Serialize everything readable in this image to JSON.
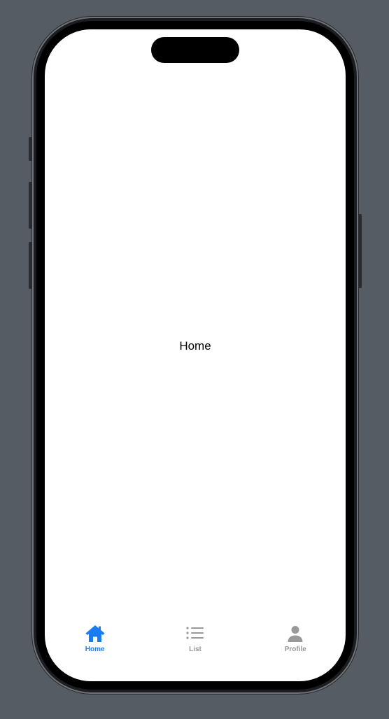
{
  "content": {
    "title": "Home"
  },
  "tab_bar": {
    "items": [
      {
        "label": "Home",
        "icon": "house-icon",
        "active": true
      },
      {
        "label": "List",
        "icon": "list-bullet-icon",
        "active": false
      },
      {
        "label": "Profile",
        "icon": "person-icon",
        "active": false
      }
    ]
  },
  "colors": {
    "accent": "#1a7cf5",
    "inactive": "#999999",
    "background": "#565c64",
    "screen": "#ffffff"
  }
}
